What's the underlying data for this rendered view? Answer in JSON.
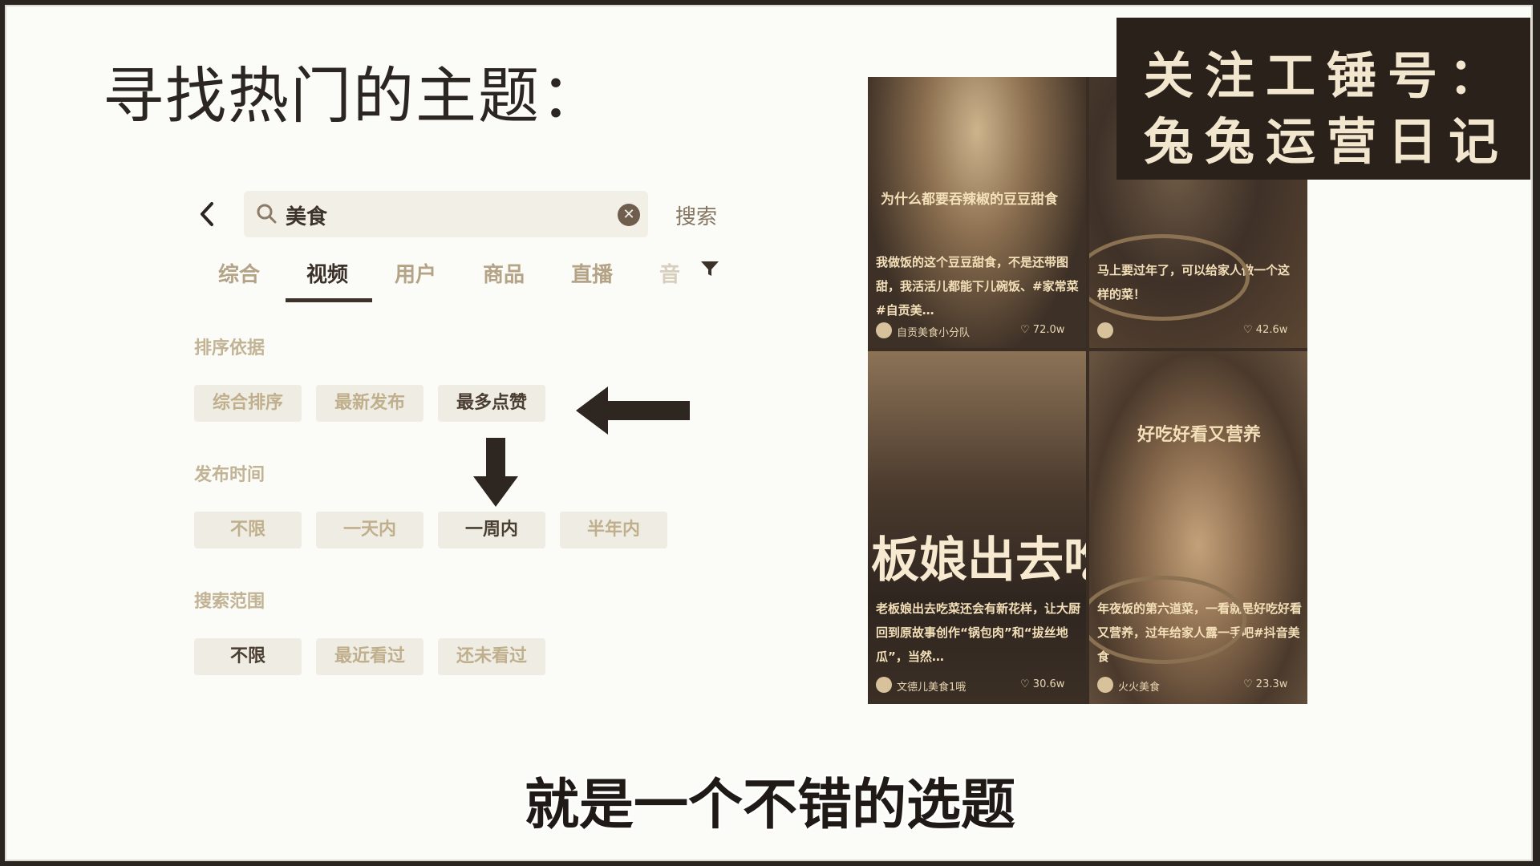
{
  "slide": {
    "title": "寻找热门的主题：",
    "subtitle": "就是一个不错的选题"
  },
  "brand": {
    "line1": "关注工锤号：",
    "line2": "兔兔运营日记"
  },
  "search": {
    "back_icon": "chevron-left-icon",
    "query": "美食",
    "clear_icon": "clear-circle-icon",
    "button_label": "搜索"
  },
  "tabs": {
    "items": [
      "综合",
      "视频",
      "用户",
      "商品",
      "直播",
      "音"
    ],
    "active": "视频",
    "filter_icon": "filter-icon"
  },
  "filters": {
    "sort": {
      "label": "排序依据",
      "options": [
        "综合排序",
        "最新发布",
        "最多点赞"
      ],
      "selected": "最多点赞"
    },
    "time": {
      "label": "发布时间",
      "options": [
        "不限",
        "一天内",
        "一周内",
        "半年内"
      ],
      "selected": "一周内"
    },
    "scope": {
      "label": "搜索范围",
      "options": [
        "不限",
        "最近看过",
        "还未看过"
      ],
      "selected": "不限"
    }
  },
  "results": [
    {
      "caption_title": "为什么都要吞辣椒的豆豆甜食",
      "caption": "我做饭的这个豆豆甜食，不是还带图甜，我活活儿都能下儿碗饭、#家常菜#自贡美…",
      "author": "自贡美食小分队",
      "likes": "72.0w"
    },
    {
      "caption": "马上要过年了，可以给家人做一个这样的菜！",
      "author": "",
      "likes": "42.6w"
    },
    {
      "big_text": "板娘出去吃",
      "caption": "老板娘出去吃菜还会有新花样，让大厨回到原故事创作“锅包肉”和“拔丝地瓜”，当然…",
      "author": "文德儿美食1哦",
      "likes": "30.6w"
    },
    {
      "overlay_title": "好吃好看又营养",
      "caption": "年夜饭的第六道菜，一看就是好吃好看又营养，过年给家人露一手吧#抖音美食",
      "author": "火火美食",
      "likes": "23.3w"
    }
  ],
  "colors": {
    "background": "#fbfbf7",
    "brand_bg": "#2a211a",
    "accent_dark": "#3b3128",
    "muted": "#c0af8d"
  }
}
